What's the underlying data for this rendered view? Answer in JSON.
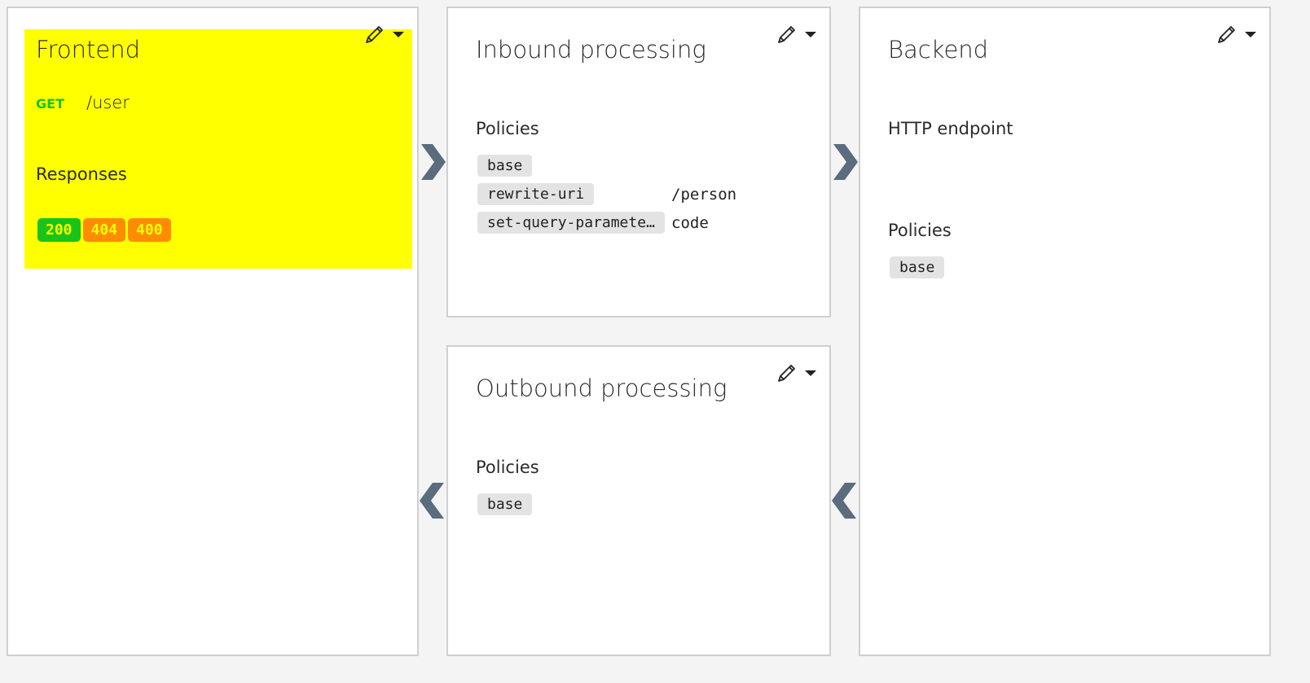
{
  "colors": {
    "highlight": "#ffff00",
    "method_get": "#19c41a",
    "status_ok": "#19c41a",
    "status_warn": "#ff8c00",
    "chevron": "#5a6c7d",
    "panel_border": "#cfcfcf"
  },
  "icons": {
    "edit": "pencil-icon",
    "menu": "caret-down-icon",
    "forward": "chevron-right-icon",
    "back": "chevron-left-icon"
  },
  "frontend": {
    "title": "Frontend",
    "method": "GET",
    "path": "/user",
    "responses_label": "Responses",
    "responses": [
      {
        "code": "200",
        "color": "#19c41a"
      },
      {
        "code": "404",
        "color": "#ff8c00"
      },
      {
        "code": "400",
        "color": "#ff8c00"
      }
    ]
  },
  "inbound": {
    "title": "Inbound processing",
    "policies_label": "Policies",
    "policies": [
      {
        "name": "base",
        "value": ""
      },
      {
        "name": "rewrite-uri",
        "value": "/person"
      },
      {
        "name": "set-query-paramete…",
        "value": "code"
      }
    ]
  },
  "outbound": {
    "title": "Outbound processing",
    "policies_label": "Policies",
    "policies": [
      {
        "name": "base"
      }
    ]
  },
  "backend": {
    "title": "Backend",
    "endpoint_label": "HTTP endpoint",
    "policies_label": "Policies",
    "policies": [
      {
        "name": "base"
      }
    ]
  }
}
